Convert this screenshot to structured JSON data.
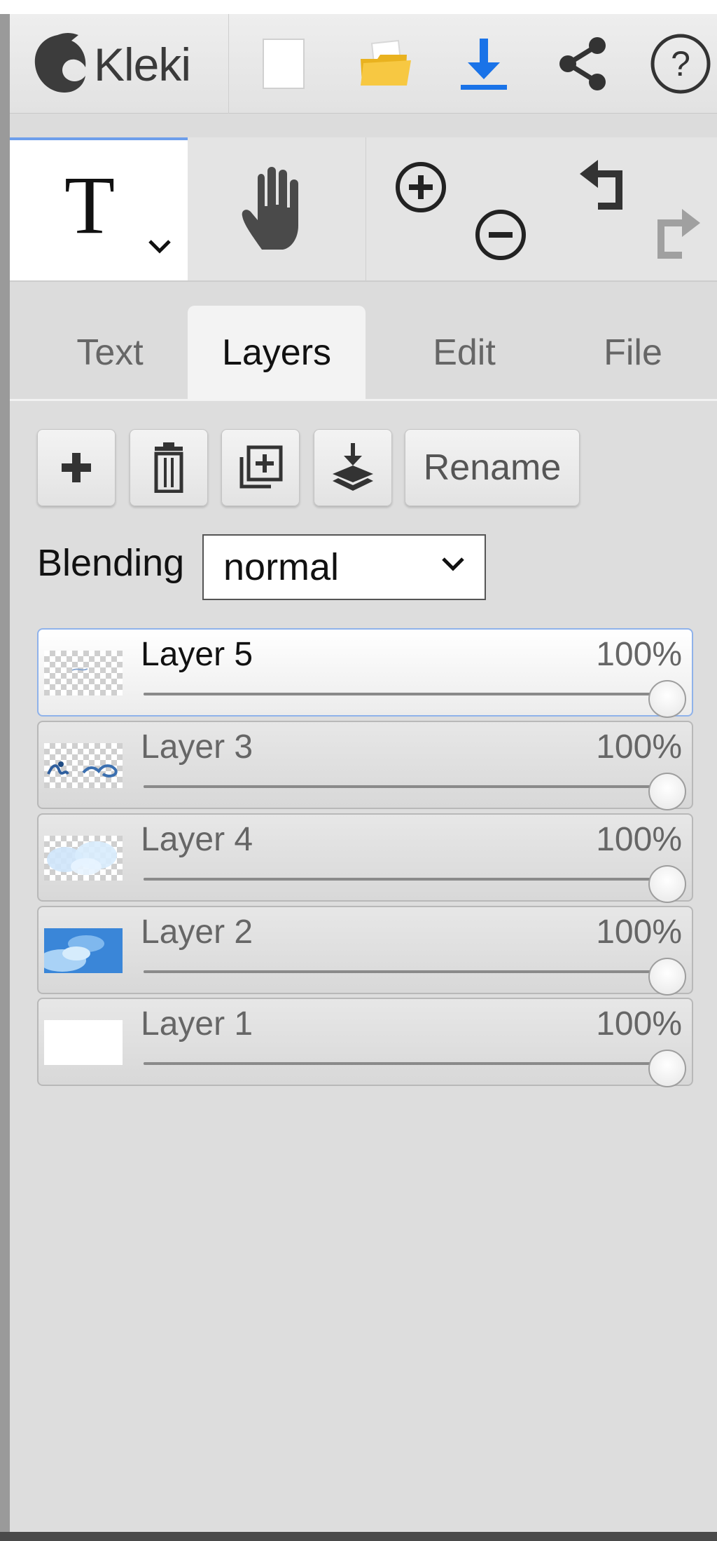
{
  "app": {
    "name": "Kleki"
  },
  "header": {
    "buttons": [
      {
        "id": "new",
        "icon": "new-image-icon"
      },
      {
        "id": "open",
        "icon": "folder-open-icon"
      },
      {
        "id": "download",
        "icon": "download-icon"
      },
      {
        "id": "share",
        "icon": "share-icon"
      },
      {
        "id": "help",
        "icon": "help-icon"
      }
    ]
  },
  "toolbar": {
    "active_tool": "text",
    "text_tool_glyph": "T",
    "tools": [
      "text",
      "hand",
      "zoom-in",
      "zoom-out",
      "undo",
      "redo"
    ]
  },
  "tabs": {
    "items": [
      {
        "label": "Text",
        "active": false
      },
      {
        "label": "Layers",
        "active": true
      },
      {
        "label": "Edit",
        "active": false
      },
      {
        "label": "File",
        "active": false
      }
    ]
  },
  "layer_actions": {
    "rename_label": "Rename",
    "icons": [
      "add-layer-icon",
      "delete-layer-icon",
      "duplicate-layer-icon",
      "merge-down-icon"
    ]
  },
  "blending": {
    "label": "Blending",
    "value": "normal"
  },
  "layers": [
    {
      "name": "Layer 5",
      "opacity_label": "100%",
      "opacity": 1.0,
      "selected": true,
      "thumb": "transparent-scribble"
    },
    {
      "name": "Layer 3",
      "opacity_label": "100%",
      "opacity": 1.0,
      "selected": false,
      "thumb": "blue-doodles"
    },
    {
      "name": "Layer 4",
      "opacity_label": "100%",
      "opacity": 1.0,
      "selected": false,
      "thumb": "light-clouds"
    },
    {
      "name": "Layer 2",
      "opacity_label": "100%",
      "opacity": 1.0,
      "selected": false,
      "thumb": "sky-clouds"
    },
    {
      "name": "Layer 1",
      "opacity_label": "100%",
      "opacity": 1.0,
      "selected": false,
      "thumb": "white"
    }
  ],
  "colors": {
    "accent": "#6d9eeb",
    "download_blue": "#1a73e8",
    "folder_yellow": "#f2c22e"
  }
}
